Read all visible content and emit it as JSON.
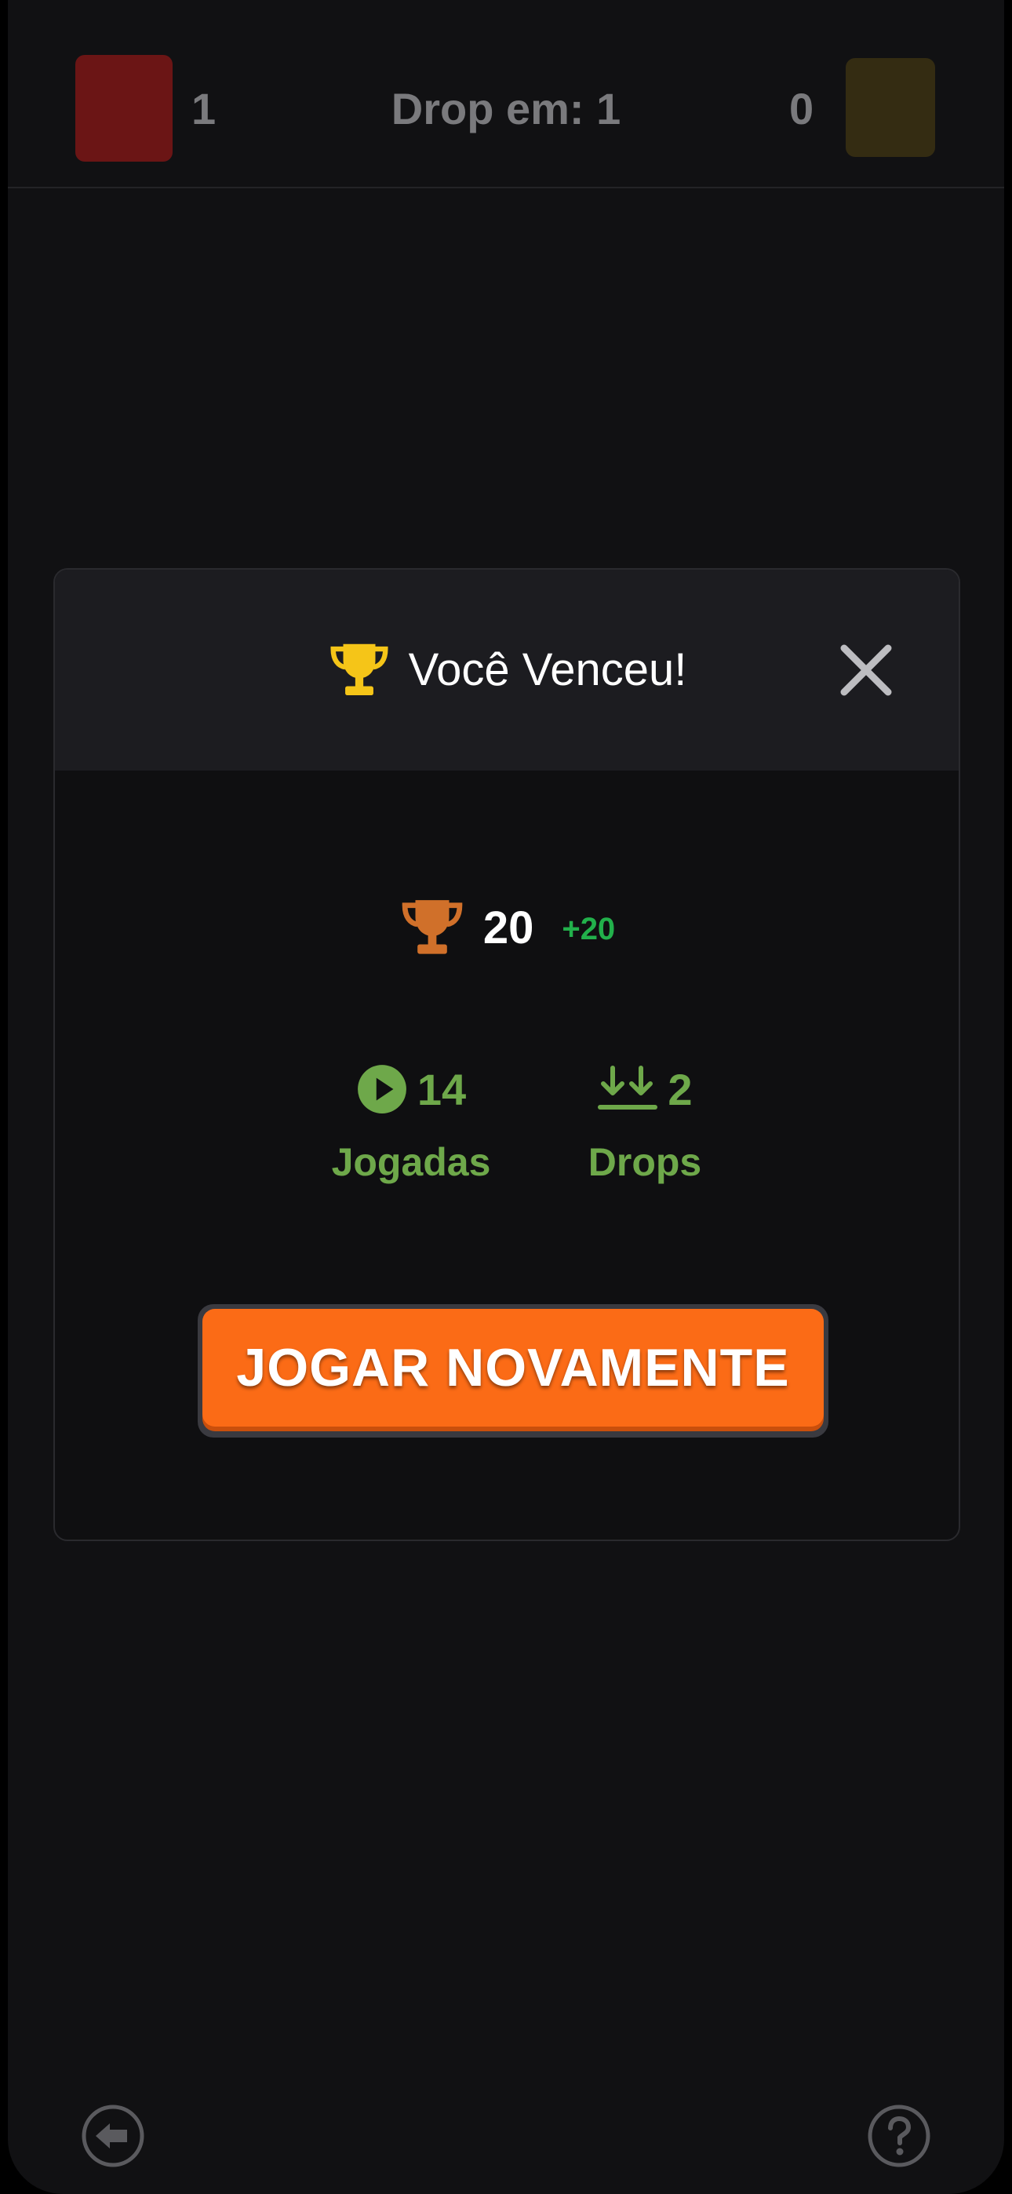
{
  "scoreboard": {
    "player1_score": "1",
    "drop_label": "Drop em: 1",
    "player2_score": "0",
    "player1_color": "#6b1515",
    "player2_color": "#342c12"
  },
  "modal": {
    "title": "Você Venceu!",
    "title_icon": "trophy-icon",
    "close_icon": "close-icon",
    "trophies": {
      "count": "20",
      "gain": "+20",
      "icon": "trophy-icon"
    },
    "stats": {
      "plays": {
        "value": "14",
        "label": "Jogadas",
        "icon": "play-circle-icon"
      },
      "drops": {
        "value": "2",
        "label": "Drops",
        "icon": "double-arrow-down-icon"
      }
    },
    "play_again_label": "JOGAR NOVAMENTE"
  },
  "footer": {
    "back_icon": "back-arrow-icon",
    "help_icon": "help-icon"
  },
  "colors": {
    "accent": "#fb6b16",
    "stat_green": "#6ea84a",
    "gain_green": "#22b04b",
    "gold_trophy": "#f5c518",
    "bronze_trophy": "#d0702a"
  }
}
